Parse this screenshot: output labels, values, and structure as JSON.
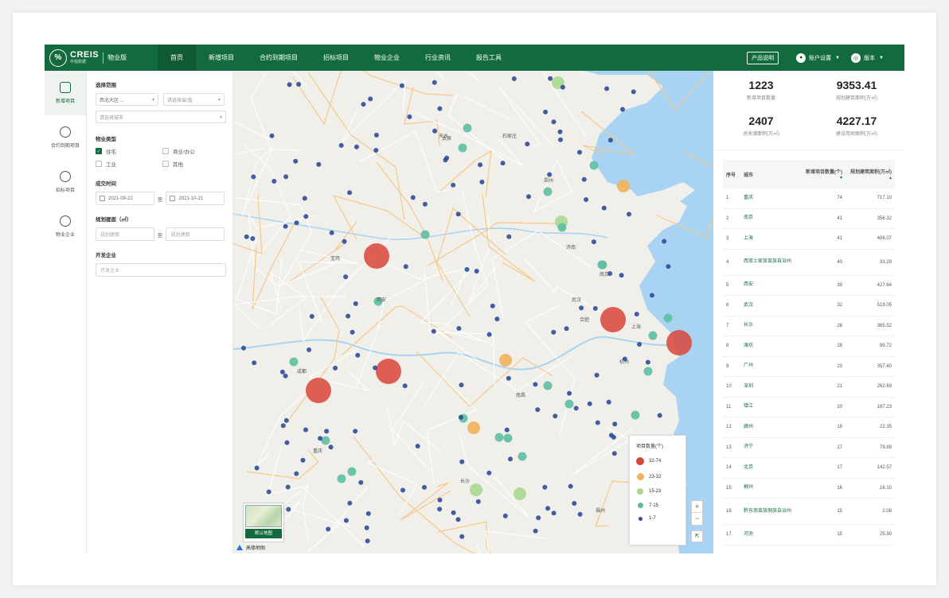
{
  "nav": {
    "logo_brand": "CREIS",
    "logo_sub": "中指数据",
    "edition": "物业版",
    "items": [
      "首页",
      "新增项目",
      "合约到期项目",
      "招标项目",
      "物业企业",
      "行业资讯",
      "报告工具"
    ],
    "active_index": 0,
    "product_btn": "产品说明",
    "account": "账户设置",
    "version": "版本"
  },
  "rail": {
    "items": [
      "新增项目",
      "合约到期项目",
      "招标项目",
      "物业企业"
    ],
    "active_index": 0
  },
  "filters": {
    "scope_title": "选择范围",
    "region_value": "西北大区",
    "region_suffix": "...",
    "province_placeholder": "请选择省/直",
    "city_placeholder": "请选择城市",
    "type_title": "物业类型",
    "types": [
      {
        "label": "住宅",
        "checked": true
      },
      {
        "label": "商业/办公",
        "checked": false
      },
      {
        "label": "工业",
        "checked": false
      },
      {
        "label": "其他",
        "checked": false
      }
    ],
    "date_title": "成交时间",
    "date_from": "2021-09-22",
    "date_to": "2021-10-21",
    "to_label": "至",
    "area_title": "规划建面（㎡）",
    "area_min_placeholder": "规划建面",
    "area_max_placeholder": "规划建面",
    "dev_title": "开发企业",
    "dev_placeholder": "开发企业"
  },
  "map": {
    "legend_title": "项目数量(个)",
    "legend": [
      {
        "label": "32-74",
        "color": "#d9453a"
      },
      {
        "label": "23-32",
        "color": "#f0b35a"
      },
      {
        "label": "15-23",
        "color": "#a8d88f"
      },
      {
        "label": "7-15",
        "color": "#5cbfa2"
      },
      {
        "label": "1-7",
        "color": "#2e4c9a"
      }
    ],
    "minimap_label": "默认地图",
    "provider": "高德地图",
    "zoom_in": "+",
    "zoom_out": "−",
    "locate": "⇱",
    "city_labels": [
      "宝鸡",
      "天水",
      "石家庄",
      "太原",
      "合肥",
      "南京",
      "上海",
      "武汉",
      "长沙",
      "重庆",
      "成都",
      "西安",
      "郑州",
      "济南",
      "杭州",
      "福州",
      "南昌"
    ]
  },
  "stats": [
    {
      "value": "1223",
      "label": "新增项目数量"
    },
    {
      "value": "9353.41",
      "label": "规划建筑面积(万㎡)"
    },
    {
      "value": "2407",
      "label": "总收储面积(万㎡)"
    },
    {
      "value": "4227.17",
      "label": "建设用地面积(万㎡)"
    }
  ],
  "table": {
    "headers": [
      "序号",
      "城市",
      "新增项目数量(个)",
      "规划建筑面积(万㎡)"
    ],
    "rows": [
      {
        "n": "1",
        "city": "重庆",
        "count": "74",
        "area": "717.10"
      },
      {
        "n": "2",
        "city": "南京",
        "count": "41",
        "area": "356.32"
      },
      {
        "n": "3",
        "city": "上海",
        "count": "41",
        "area": "406.07"
      },
      {
        "n": "4",
        "city": "西双土家族苗族自治州",
        "count": "40",
        "area": "33.29"
      },
      {
        "n": "5",
        "city": "西安",
        "count": "39",
        "area": "427.64"
      },
      {
        "n": "6",
        "city": "武汉",
        "count": "32",
        "area": "519.05"
      },
      {
        "n": "7",
        "city": "长沙",
        "count": "28",
        "area": "365.52"
      },
      {
        "n": "8",
        "city": "潍坊",
        "count": "28",
        "area": "99.72"
      },
      {
        "n": "9",
        "city": "广州",
        "count": "23",
        "area": "357.40"
      },
      {
        "n": "10",
        "city": "深圳",
        "count": "21",
        "area": "262.69"
      },
      {
        "n": "11",
        "city": "镇江",
        "count": "20",
        "area": "167.23"
      },
      {
        "n": "12",
        "city": "赣州",
        "count": "19",
        "area": "22.35"
      },
      {
        "n": "13",
        "city": "济宁",
        "count": "17",
        "area": "79.89"
      },
      {
        "n": "14",
        "city": "北京",
        "count": "17",
        "area": "142.57"
      },
      {
        "n": "15",
        "city": "郴州",
        "count": "16",
        "area": "16.10"
      },
      {
        "n": "16",
        "city": "黔东南苗族侗族自治州",
        "count": "15",
        "area": "2.08"
      },
      {
        "n": "17",
        "city": "河池",
        "count": "15",
        "area": "25.90"
      }
    ]
  }
}
